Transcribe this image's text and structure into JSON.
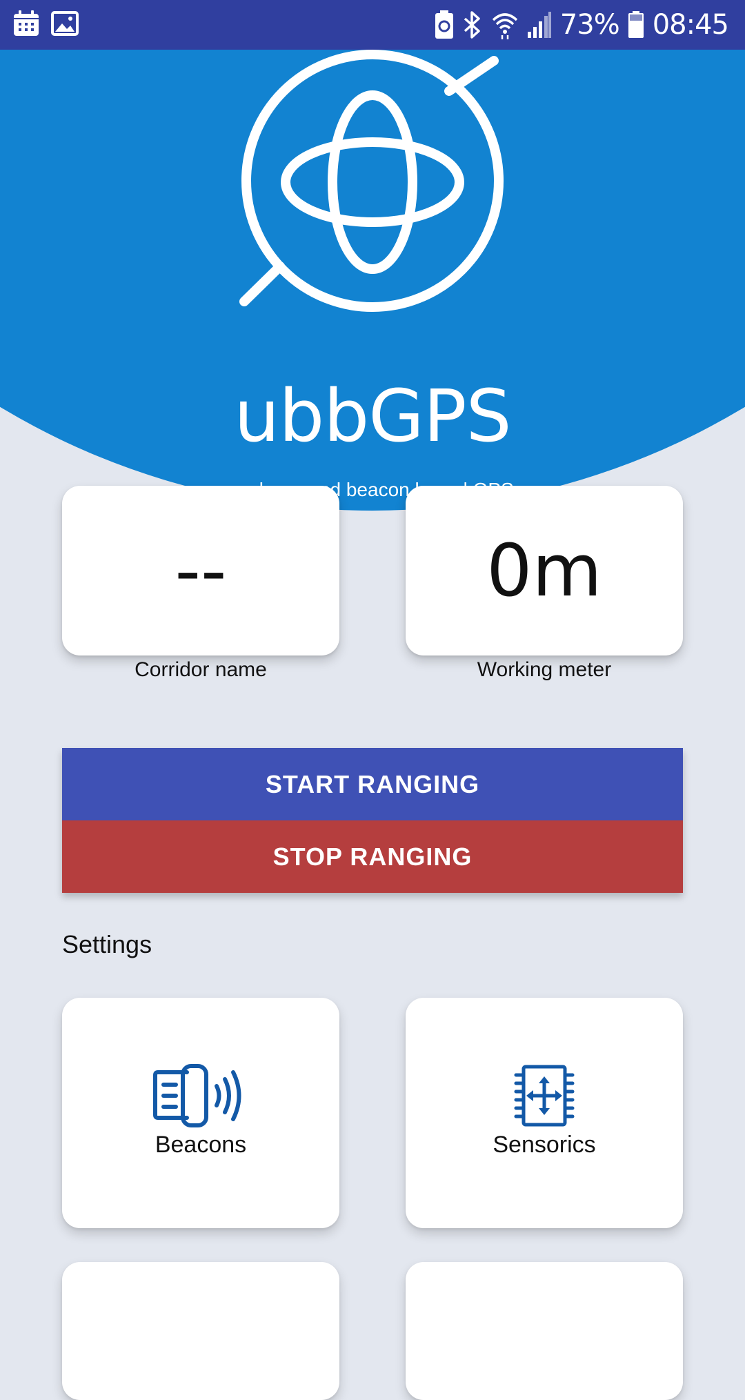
{
  "status_bar": {
    "left_icons": [
      "calendar-icon",
      "image-icon"
    ],
    "right_icons": [
      "battery-saver-icon",
      "bluetooth-icon",
      "wifi-icon",
      "signal-icon"
    ],
    "battery_percent": "73%",
    "time": "08:45"
  },
  "header": {
    "logo_icon": "globe-satellite-icon",
    "app_title": "ubbGPS",
    "subtitle": "underground beacon based GPS"
  },
  "stats": {
    "corridor": {
      "value": "--",
      "label": "Corridor name"
    },
    "meter": {
      "value": "0m",
      "label": "Working meter"
    }
  },
  "actions": {
    "start_label": "START RANGING",
    "stop_label": "STOP RANGING"
  },
  "settings": {
    "heading": "Settings",
    "tiles": [
      {
        "label": "Beacons",
        "icon": "beacon-icon"
      },
      {
        "label": "Sensorics",
        "icon": "sensor-chip-icon"
      }
    ]
  },
  "colors": {
    "status_bar": "#303f9f",
    "header_blue": "#1283d1",
    "start_button": "#3f51b5",
    "stop_button": "#b53e3e",
    "icon_blue": "#1359a7",
    "background": "#e3e7ef"
  }
}
